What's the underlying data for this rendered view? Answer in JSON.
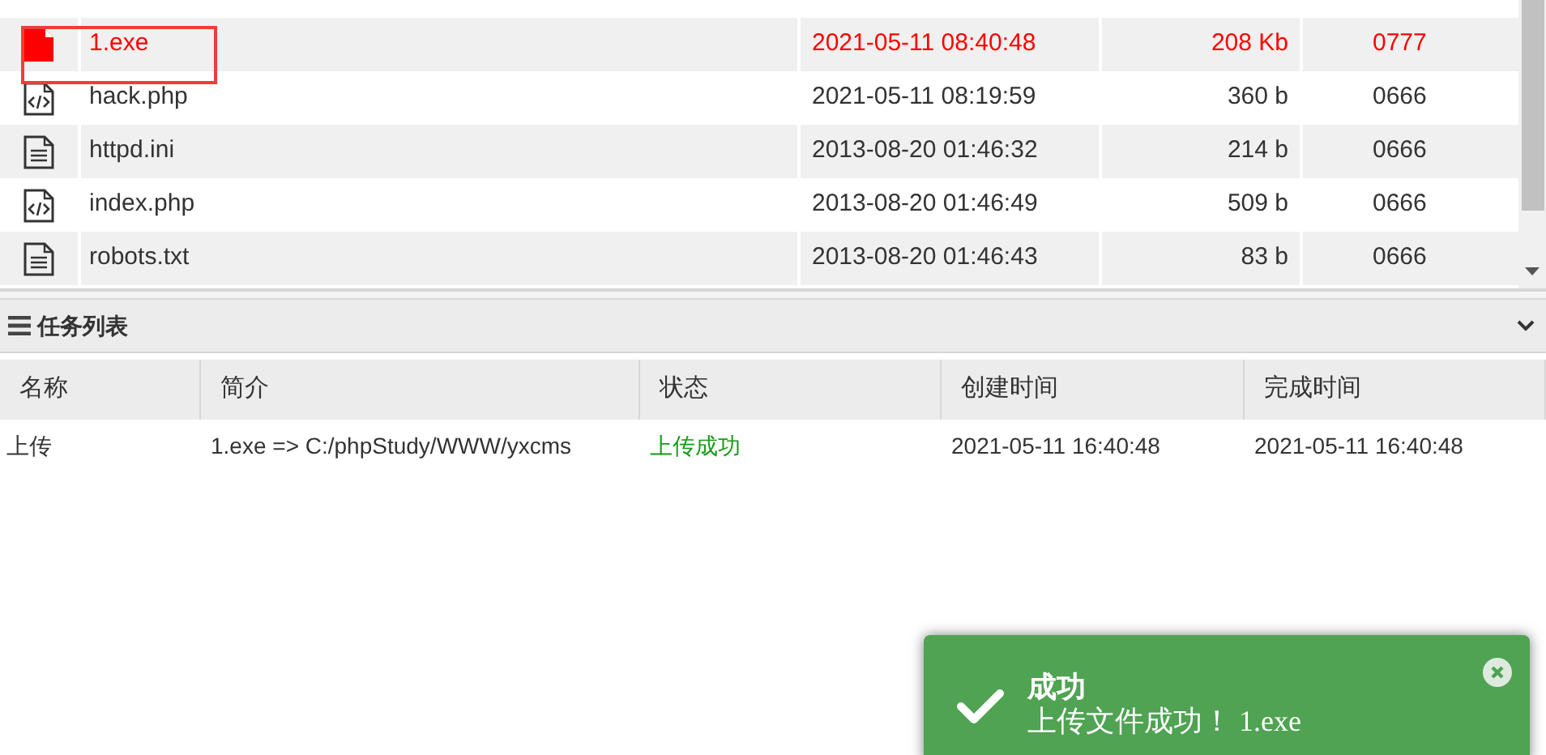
{
  "files": [
    {
      "name": "1.exe",
      "kind": "exe",
      "modified": "2021-05-11 08:40:48",
      "size": "208 Kb",
      "perms": "0777",
      "highlighted": true
    },
    {
      "name": "hack.php",
      "kind": "code",
      "modified": "2021-05-11 08:19:59",
      "size": "360 b",
      "perms": "0666",
      "highlighted": false
    },
    {
      "name": "httpd.ini",
      "kind": "text",
      "modified": "2013-08-20 01:46:32",
      "size": "214 b",
      "perms": "0666",
      "highlighted": false
    },
    {
      "name": "index.php",
      "kind": "code",
      "modified": "2013-08-20 01:46:49",
      "size": "509 b",
      "perms": "0666",
      "highlighted": false
    },
    {
      "name": "robots.txt",
      "kind": "text",
      "modified": "2013-08-20 01:46:43",
      "size": "83 b",
      "perms": "0666",
      "highlighted": false
    }
  ],
  "task_panel": {
    "title": "任务列表",
    "columns": [
      "名称",
      "简介",
      "状态",
      "创建时间",
      "完成时间"
    ],
    "rows": [
      {
        "name": "上传",
        "description": "1.exe => C:/phpStudy/WWW/yxcms",
        "status": "上传成功",
        "created": "2021-05-11 16:40:48",
        "finished": "2021-05-11 16:40:48"
      }
    ]
  },
  "toast": {
    "title": "成功",
    "message": "上传文件成功！ 1.exe"
  }
}
